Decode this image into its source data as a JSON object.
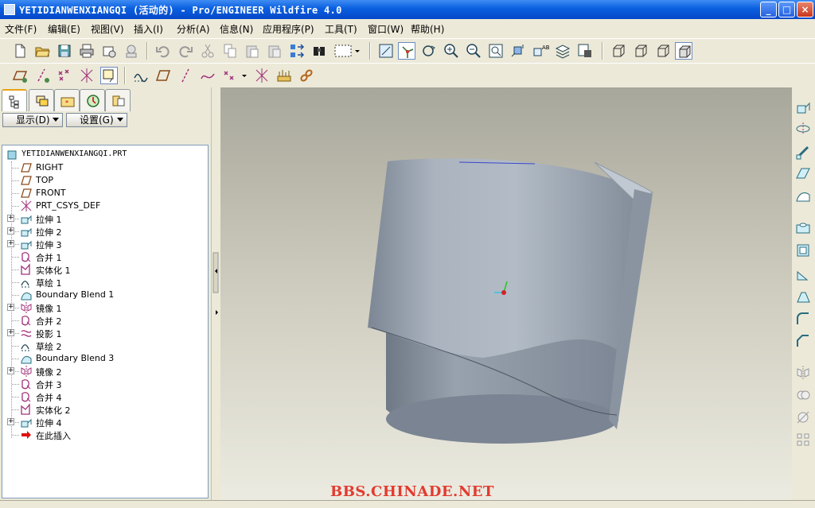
{
  "window": {
    "title": "YETIDIANWENXIANGQI (活动的) - Pro/ENGINEER Wildfire 4.0",
    "minimize_glyph": "_",
    "maximize_glyph": "□",
    "close_glyph": "×"
  },
  "menu": [
    "文件(F)",
    "编辑(E)",
    "视图(V)",
    "插入(I)",
    "分析(A)",
    "信息(N)",
    "应用程序(P)",
    "工具(T)",
    "窗口(W)",
    "帮助(H)"
  ],
  "toolbar1_icons": [
    "new-icon",
    "open-icon",
    "save-icon",
    "print-icon",
    "send-mail-icon",
    "mail-recipient-icon",
    "undo-icon",
    "redo-icon",
    "cut-icon",
    "copy-icon",
    "paste-icon",
    "paste-special-icon",
    "regenerate-icon",
    "find-icon",
    "select-box-icon",
    "repaint-icon",
    "spin-center-icon",
    "orient-icon",
    "zoom-in-icon",
    "zoom-out-icon",
    "refit-icon",
    "reorient-icon",
    "saved-views-icon",
    "layers-icon",
    "view-manager-icon",
    "wireframe-icon",
    "hidden-line-icon",
    "no-hidden-icon",
    "shading-icon"
  ],
  "toolbar2_icons": [
    "datum-plane-display-icon",
    "datum-axis-display-icon",
    "point-display-icon",
    "csys-display-icon",
    "annotation-display-icon",
    "sketch-tool-icon",
    "datum-plane-icon",
    "datum-axis-icon",
    "datum-curve-icon",
    "datum-point-icon",
    "datum-csys-icon",
    "analysis-feature-icon",
    "chain-icon"
  ],
  "panel": {
    "tabs": [
      "model-tree-tab-icon",
      "layer-tree-tab-icon",
      "favorites-tab-icon",
      "history-tab-icon",
      "connections-tab-icon"
    ],
    "show_button": "显示(D)",
    "settings_button": "设置(G)"
  },
  "tree": [
    {
      "label": "YETIDIANWENXIANGQI.PRT",
      "icon": "part-icon",
      "expandable": false,
      "root": true
    },
    {
      "label": "RIGHT",
      "icon": "datum-plane-icon",
      "expandable": false
    },
    {
      "label": "TOP",
      "icon": "datum-plane-icon",
      "expandable": false
    },
    {
      "label": "FRONT",
      "icon": "datum-plane-icon",
      "expandable": false
    },
    {
      "label": "PRT_CSYS_DEF",
      "icon": "csys-icon",
      "expandable": false
    },
    {
      "label": "拉伸 1",
      "icon": "extrude-icon",
      "expandable": true
    },
    {
      "label": "拉伸 2",
      "icon": "extrude-icon",
      "expandable": true
    },
    {
      "label": "拉伸 3",
      "icon": "extrude-icon",
      "expandable": true
    },
    {
      "label": "合并 1",
      "icon": "merge-icon",
      "expandable": false
    },
    {
      "label": "实体化 1",
      "icon": "solidify-icon",
      "expandable": false
    },
    {
      "label": "草绘 1",
      "icon": "sketch-icon",
      "expandable": false
    },
    {
      "label": "Boundary Blend 1",
      "icon": "boundary-blend-icon",
      "expandable": false
    },
    {
      "label": "镜像 1",
      "icon": "mirror-icon",
      "expandable": true
    },
    {
      "label": "合并 2",
      "icon": "merge-icon",
      "expandable": false
    },
    {
      "label": "投影 1",
      "icon": "project-icon",
      "expandable": true
    },
    {
      "label": "草绘 2",
      "icon": "sketch-icon",
      "expandable": false
    },
    {
      "label": "Boundary Blend 3",
      "icon": "boundary-blend-icon",
      "expandable": false
    },
    {
      "label": "镜像 2",
      "icon": "mirror-icon",
      "expandable": true
    },
    {
      "label": "合并 3",
      "icon": "merge-icon",
      "expandable": false
    },
    {
      "label": "合并 4",
      "icon": "merge-icon",
      "expandable": false
    },
    {
      "label": "实体化 2",
      "icon": "solidify-icon",
      "expandable": false
    },
    {
      "label": "拉伸 4",
      "icon": "extrude-icon",
      "expandable": true
    },
    {
      "label": "在此插入",
      "icon": "insert-here-arrow-icon",
      "expandable": false
    }
  ],
  "right_toolbar_icons": [
    "extrude-tool-icon",
    "revolve-tool-icon",
    "sweep-tool-icon",
    "blend-tool-icon",
    "style-tool-icon",
    "hole-tool-icon",
    "shell-tool-icon",
    "rib-tool-icon",
    "draft-tool-icon",
    "round-tool-icon",
    "chamfer-tool-icon",
    "mirror-tool-icon",
    "merge-tool-icon",
    "trim-tool-icon",
    "pattern-tool-icon"
  ],
  "viewport": {
    "watermark": "BBS.CHINADE.NET",
    "model_color": "#9ea8b4",
    "background_top": "#a8a79b",
    "background_bottom": "#ecebe1"
  },
  "colors": {
    "titlebar": "#0a5fe0",
    "accent_icon": "#a0307a",
    "watermark": "#e23a30"
  }
}
